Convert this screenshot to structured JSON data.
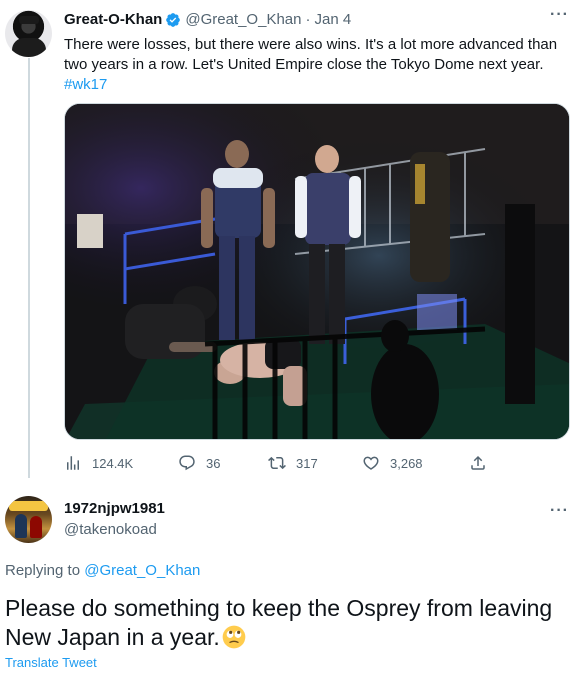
{
  "tweet": {
    "author_name": "Great-O-Khan",
    "author_handle": "@Great_O_Khan",
    "separator": "·",
    "date": "Jan 4",
    "more_label": "···",
    "text": "There were losses, but there were also wins. It's a lot more advanced than two years in a row. Let's United Empire close the Tokyo Dome next year.",
    "hashtag": "#wk17",
    "media_description_icon": "photo",
    "actions": {
      "views": "124.4K",
      "replies": "36",
      "retweets": "317",
      "likes": "3,268"
    }
  },
  "reply": {
    "author_name": "1972njpw1981",
    "author_handle": "@takenokoad",
    "more_label": "···",
    "replying_prefix": "Replying to",
    "replying_to": "@Great_O_Khan",
    "text": "Please do something to keep the Osprey from leaving New Japan in a year.",
    "emoji": "rolling-eyes",
    "translate_label": "Translate Tweet"
  },
  "colors": {
    "accent": "#1d9bf0",
    "secondary_text": "#536471",
    "primary_text": "#0f1419",
    "border": "#cfd9de"
  }
}
